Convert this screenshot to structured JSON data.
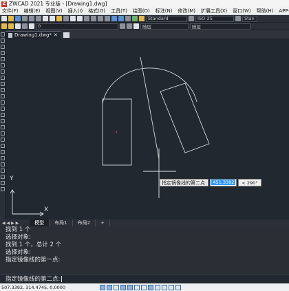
{
  "window": {
    "title": "ZWCAD 2021 专业版 - [Drawing1.dwg]",
    "app_icon": "Z"
  },
  "menu": {
    "items": [
      "文件(F)",
      "编辑(E)",
      "视图(V)",
      "插入(I)",
      "格式(O)",
      "工具(T)",
      "绘图(D)",
      "标注(N)",
      "修改(M)",
      "扩展工具(X)",
      "窗口(W)",
      "帮助(H)",
      "APP+"
    ]
  },
  "toolbar": {
    "text_style": "Standard",
    "dim_style": "ISO-25",
    "table_style": "Stan",
    "layer": "0",
    "color": "随层",
    "linetype": "随层"
  },
  "document": {
    "tab_label": "Drawing1.dwg*"
  },
  "canvas": {
    "ucs_x": "X",
    "ucs_y": "Y"
  },
  "prompt": {
    "label": "指定镜像线的第二点:",
    "value": "451.3392",
    "angle": "< 290°"
  },
  "layout_tabs": {
    "nav": "◀ ◀ ▶ ▶",
    "tabs": [
      "模型",
      "布局1",
      "布局2"
    ],
    "add": "+"
  },
  "command_history": [
    "找到 1 个",
    "选择对象:",
    "找到 1 个，总计 2 个",
    "选择对象:",
    "指定镜像线的第一点:"
  ],
  "command_input": "指定镜像线的第二点:",
  "status": {
    "coords": "507.3392, 314.4745, 0.0000"
  },
  "colors": {
    "canvas_bg": "#212830",
    "geometry": "#d9d9d9",
    "highlight": "#3399ff"
  }
}
